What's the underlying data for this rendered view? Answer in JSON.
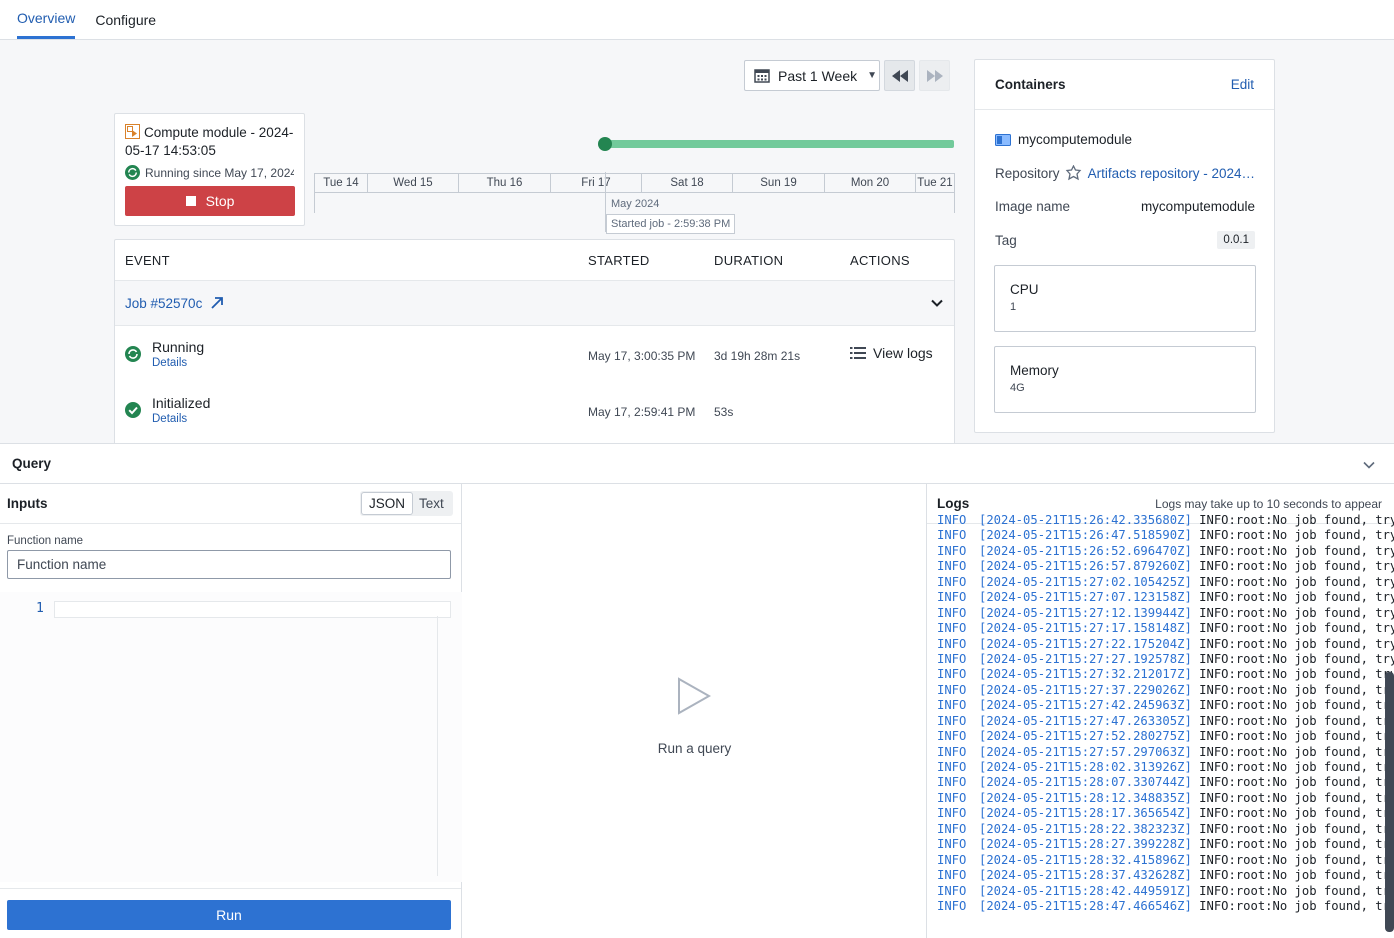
{
  "tabs": [
    {
      "label": "Overview",
      "active": true
    },
    {
      "label": "Configure",
      "active": false
    }
  ],
  "toolbar": {
    "range_label": "Past 1 Week"
  },
  "deployment": {
    "title": "Compute module - 2024-05-17 14:53:05",
    "status": "Running since May 17, 2024…",
    "stop_label": "Stop"
  },
  "timeline": {
    "days": [
      "Tue 14",
      "Wed 15",
      "Thu 16",
      "Fri 17",
      "Sat 18",
      "Sun 19",
      "Mon 20",
      "Tue 21"
    ],
    "month": "May 2024",
    "tooltip": "Started job - 2:59:38 PM"
  },
  "events": {
    "columns": [
      "EVENT",
      "STARTED",
      "DURATION",
      "ACTIONS"
    ],
    "job_label": "Job #52570c",
    "rows": [
      {
        "status": "Running",
        "details": "Details",
        "started": "May 17, 3:00:35 PM",
        "duration": "3d 19h 28m 21s",
        "action": "View logs"
      },
      {
        "status": "Initialized",
        "details": "Details",
        "started": "May 17, 2:59:41 PM",
        "duration": "53s",
        "action": ""
      }
    ]
  },
  "containers": {
    "title": "Containers",
    "edit_label": "Edit",
    "name": "mycomputemodule",
    "repository_label": "Repository",
    "repository_value": "Artifacts repository - 2024…",
    "image_label": "Image name",
    "image_value": "mycomputemodule",
    "tag_label": "Tag",
    "tag_value": "0.0.1",
    "cpu_label": "CPU",
    "cpu_value": "1",
    "memory_label": "Memory",
    "memory_value": "4G"
  },
  "query": {
    "title": "Query",
    "inputs_title": "Inputs",
    "mode_json": "JSON",
    "mode_text": "Text",
    "function_label": "Function name",
    "function_placeholder": "Function name",
    "line_number": "1",
    "run_label": "Run",
    "empty_label": "Run a query"
  },
  "logs": {
    "title": "Logs",
    "hint": "Logs may take up to 10 seconds to appear",
    "lines": [
      {
        "level": "INFO",
        "ts": "[2024-05-21T15:26:42.335680Z]",
        "msg": "INFO:root:No job found, try"
      },
      {
        "level": "INFO",
        "ts": "[2024-05-21T15:26:47.518590Z]",
        "msg": "INFO:root:No job found, try"
      },
      {
        "level": "INFO",
        "ts": "[2024-05-21T15:26:52.696470Z]",
        "msg": "INFO:root:No job found, try"
      },
      {
        "level": "INFO",
        "ts": "[2024-05-21T15:26:57.879260Z]",
        "msg": "INFO:root:No job found, try"
      },
      {
        "level": "INFO",
        "ts": "[2024-05-21T15:27:02.105425Z]",
        "msg": "INFO:root:No job found, try"
      },
      {
        "level": "INFO",
        "ts": "[2024-05-21T15:27:07.123158Z]",
        "msg": "INFO:root:No job found, try"
      },
      {
        "level": "INFO",
        "ts": "[2024-05-21T15:27:12.139944Z]",
        "msg": "INFO:root:No job found, try"
      },
      {
        "level": "INFO",
        "ts": "[2024-05-21T15:27:17.158148Z]",
        "msg": "INFO:root:No job found, try"
      },
      {
        "level": "INFO",
        "ts": "[2024-05-21T15:27:22.175204Z]",
        "msg": "INFO:root:No job found, try"
      },
      {
        "level": "INFO",
        "ts": "[2024-05-21T15:27:27.192578Z]",
        "msg": "INFO:root:No job found, try"
      },
      {
        "level": "INFO",
        "ts": "[2024-05-21T15:27:32.212017Z]",
        "msg": "INFO:root:No job found, try"
      },
      {
        "level": "INFO",
        "ts": "[2024-05-21T15:27:37.229026Z]",
        "msg": "INFO:root:No job found, try"
      },
      {
        "level": "INFO",
        "ts": "[2024-05-21T15:27:42.245963Z]",
        "msg": "INFO:root:No job found, try"
      },
      {
        "level": "INFO",
        "ts": "[2024-05-21T15:27:47.263305Z]",
        "msg": "INFO:root:No job found, try"
      },
      {
        "level": "INFO",
        "ts": "[2024-05-21T15:27:52.280275Z]",
        "msg": "INFO:root:No job found, try"
      },
      {
        "level": "INFO",
        "ts": "[2024-05-21T15:27:57.297063Z]",
        "msg": "INFO:root:No job found, try"
      },
      {
        "level": "INFO",
        "ts": "[2024-05-21T15:28:02.313926Z]",
        "msg": "INFO:root:No job found, try"
      },
      {
        "level": "INFO",
        "ts": "[2024-05-21T15:28:07.330744Z]",
        "msg": "INFO:root:No job found, try"
      },
      {
        "level": "INFO",
        "ts": "[2024-05-21T15:28:12.348835Z]",
        "msg": "INFO:root:No job found, try"
      },
      {
        "level": "INFO",
        "ts": "[2024-05-21T15:28:17.365654Z]",
        "msg": "INFO:root:No job found, try"
      },
      {
        "level": "INFO",
        "ts": "[2024-05-21T15:28:22.382323Z]",
        "msg": "INFO:root:No job found, try"
      },
      {
        "level": "INFO",
        "ts": "[2024-05-21T15:28:27.399228Z]",
        "msg": "INFO:root:No job found, try"
      },
      {
        "level": "INFO",
        "ts": "[2024-05-21T15:28:32.415896Z]",
        "msg": "INFO:root:No job found, try"
      },
      {
        "level": "INFO",
        "ts": "[2024-05-21T15:28:37.432628Z]",
        "msg": "INFO:root:No job found, try"
      },
      {
        "level": "INFO",
        "ts": "[2024-05-21T15:28:42.449591Z]",
        "msg": "INFO:root:No job found, try"
      },
      {
        "level": "INFO",
        "ts": "[2024-05-21T15:28:47.466546Z]",
        "msg": "INFO:root:No job found, try"
      }
    ]
  },
  "colors": {
    "accent": "#2d72d2",
    "link": "#215db0",
    "danger": "#cd4246",
    "success": "#238551"
  }
}
